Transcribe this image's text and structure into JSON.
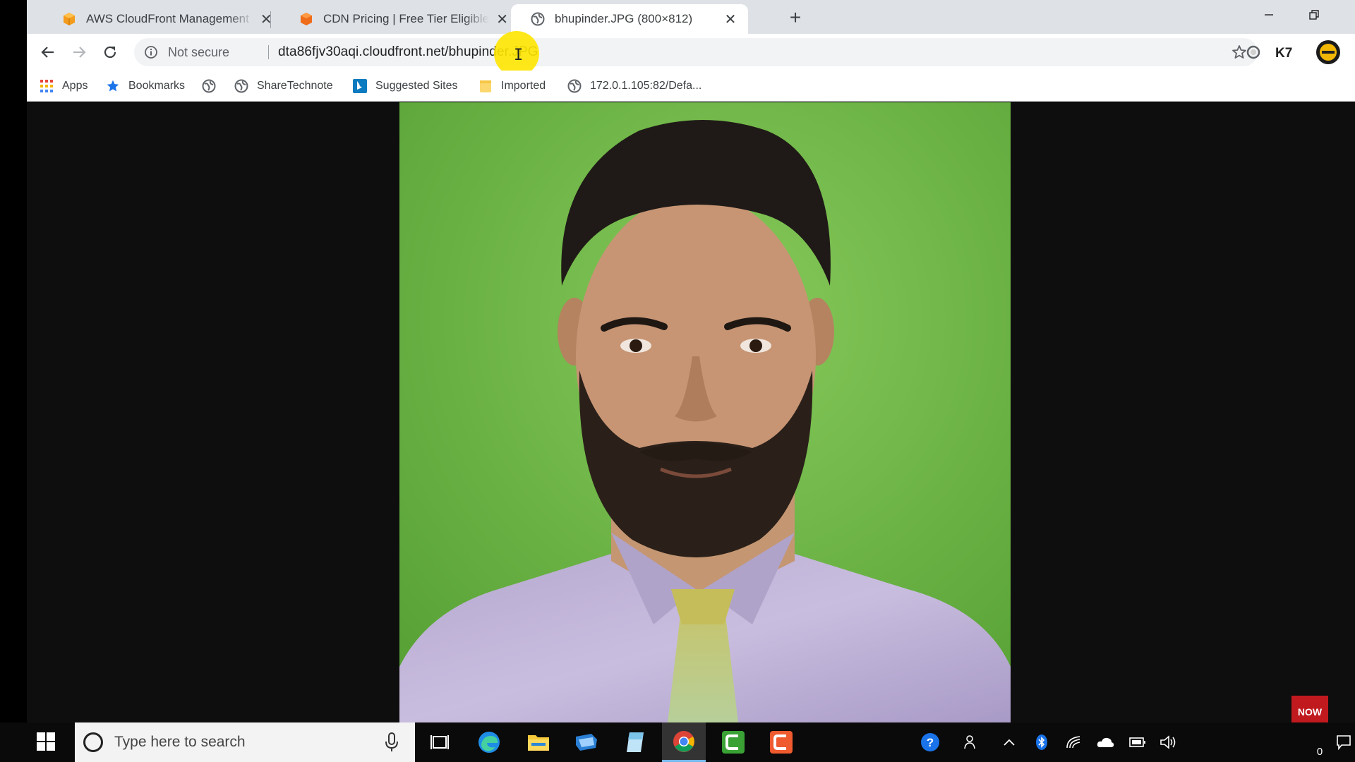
{
  "browser": {
    "tabs": [
      {
        "title": "AWS CloudFront Management Console",
        "favicon": "aws-cube-icon",
        "active": false
      },
      {
        "title": "CDN Pricing | Free Tier Eligible, Pay-as-you-go",
        "favicon": "aws-box-icon",
        "active": false
      },
      {
        "title": "bhupinder.JPG (800×812)",
        "favicon": "globe-icon",
        "active": true
      }
    ],
    "new_tab": "+",
    "omnibox": {
      "security_label": "Not secure",
      "url": "dta86fjv30aqi.cloudfront.net/bhupinder.JPG"
    },
    "bookmarks": [
      {
        "label": "Apps",
        "icon": "apps-grid-icon"
      },
      {
        "label": "Bookmarks",
        "icon": "star-icon"
      },
      {
        "label": "",
        "icon": "globe-icon"
      },
      {
        "label": "ShareTechnote",
        "icon": "globe-icon"
      },
      {
        "label": "Suggested Sites",
        "icon": "bing-icon"
      },
      {
        "label": "Imported",
        "icon": "folder-icon"
      },
      {
        "label": "172.0.1.105:82/Defa...",
        "icon": "globe-icon"
      }
    ]
  },
  "content": {
    "image_alt": "bhupinder.JPG"
  },
  "taskbar": {
    "search_placeholder": "Type here to search",
    "notification_count": "0"
  },
  "colors": {
    "tabbar": "#dee1e6",
    "omnibox": "#f1f3f4",
    "green_screen": "#6fbb45",
    "shirt": "#b8a9d4",
    "cursor_highlight": "#ffe600"
  }
}
